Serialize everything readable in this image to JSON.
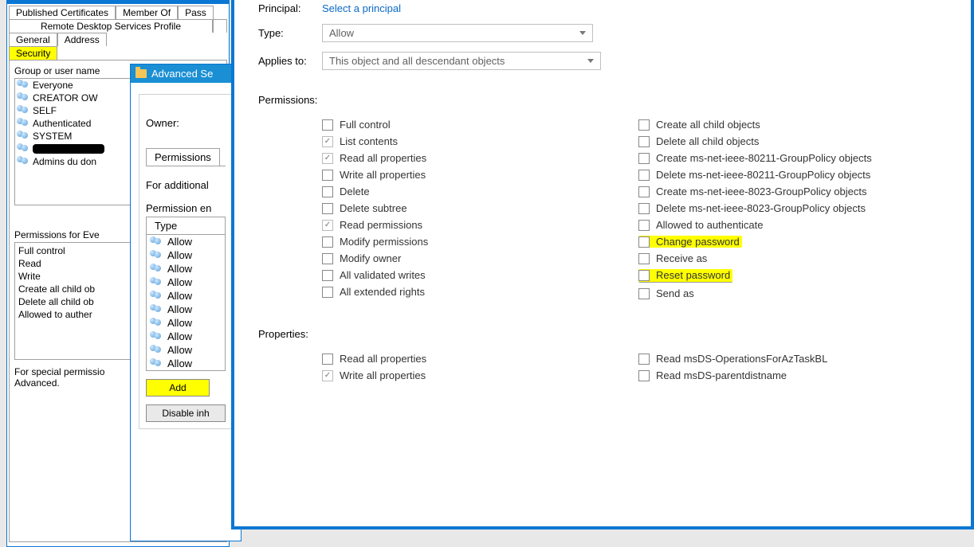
{
  "win1": {
    "tabs_row1": [
      "Published Certificates",
      "Member Of",
      "Pass"
    ],
    "tabs_row2": [
      "Remote Desktop Services Profile"
    ],
    "tabs_row3": [
      "General",
      "Address"
    ],
    "tabs_row4": [
      "Security"
    ],
    "group_label": "Group or user name",
    "groups": [
      "Everyone",
      "CREATOR OW",
      "SELF",
      "Authenticated",
      "SYSTEM",
      "",
      "Admins du don"
    ],
    "perm_for_label": "Permissions for Eve",
    "perm_for_list": [
      "Full control",
      "Read",
      "Write",
      "Create all child ob",
      "Delete all child ob",
      "Allowed to auther"
    ],
    "special_note1": "For special permissio",
    "special_note2": "Advanced."
  },
  "win2": {
    "title": "Advanced Se",
    "owner_label": "Owner:",
    "perm_tab": "Permissions",
    "additional_label": "For additional",
    "entries_label": "Permission en",
    "type_header": "Type",
    "rows": [
      "Allow",
      "Allow",
      "Allow",
      "Allow",
      "Allow",
      "Allow",
      "Allow",
      "Allow",
      "Allow",
      "Allow"
    ],
    "add_btn": "Add",
    "disable_btn": "Disable inh"
  },
  "win3": {
    "principal_label": "Principal:",
    "principal_link": "Select a principal",
    "type_label": "Type:",
    "type_value": "Allow",
    "applies_label": "Applies to:",
    "applies_value": "This object and all descendant objects",
    "permissions_header": "Permissions:",
    "left_perms": [
      {
        "label": "Full control",
        "checked": false
      },
      {
        "label": "List contents",
        "checked": true
      },
      {
        "label": "Read all properties",
        "checked": true
      },
      {
        "label": "Write all properties",
        "checked": false
      },
      {
        "label": "Delete",
        "checked": false
      },
      {
        "label": "Delete subtree",
        "checked": false
      },
      {
        "label": "Read permissions",
        "checked": true
      },
      {
        "label": "Modify permissions",
        "checked": false
      },
      {
        "label": "Modify owner",
        "checked": false
      },
      {
        "label": "All validated writes",
        "checked": false
      },
      {
        "label": "All extended rights",
        "checked": false
      }
    ],
    "right_perms": [
      {
        "label": "Create all child objects",
        "checked": false,
        "hl": false
      },
      {
        "label": "Delete all child objects",
        "checked": false,
        "hl": false
      },
      {
        "label": "Create ms-net-ieee-80211-GroupPolicy objects",
        "checked": false,
        "hl": false
      },
      {
        "label": "Delete ms-net-ieee-80211-GroupPolicy objects",
        "checked": false,
        "hl": false
      },
      {
        "label": "Create ms-net-ieee-8023-GroupPolicy objects",
        "checked": false,
        "hl": false
      },
      {
        "label": "Delete ms-net-ieee-8023-GroupPolicy objects",
        "checked": false,
        "hl": false
      },
      {
        "label": "Allowed to authenticate",
        "checked": false,
        "hl": false
      },
      {
        "label": "Change password",
        "checked": false,
        "hl": true
      },
      {
        "label": "Receive as",
        "checked": false,
        "hl": false
      },
      {
        "label": "Reset password",
        "checked": false,
        "hl": true
      },
      {
        "label": "Send as",
        "checked": false,
        "hl": false
      }
    ],
    "properties_header": "Properties:",
    "left_props": [
      {
        "label": "Read all properties",
        "checked": false
      },
      {
        "label": "Write all properties",
        "checked": true
      }
    ],
    "right_props": [
      {
        "label": "Read msDS-OperationsForAzTaskBL",
        "checked": false
      },
      {
        "label": "Read msDS-parentdistname",
        "checked": false
      }
    ]
  }
}
